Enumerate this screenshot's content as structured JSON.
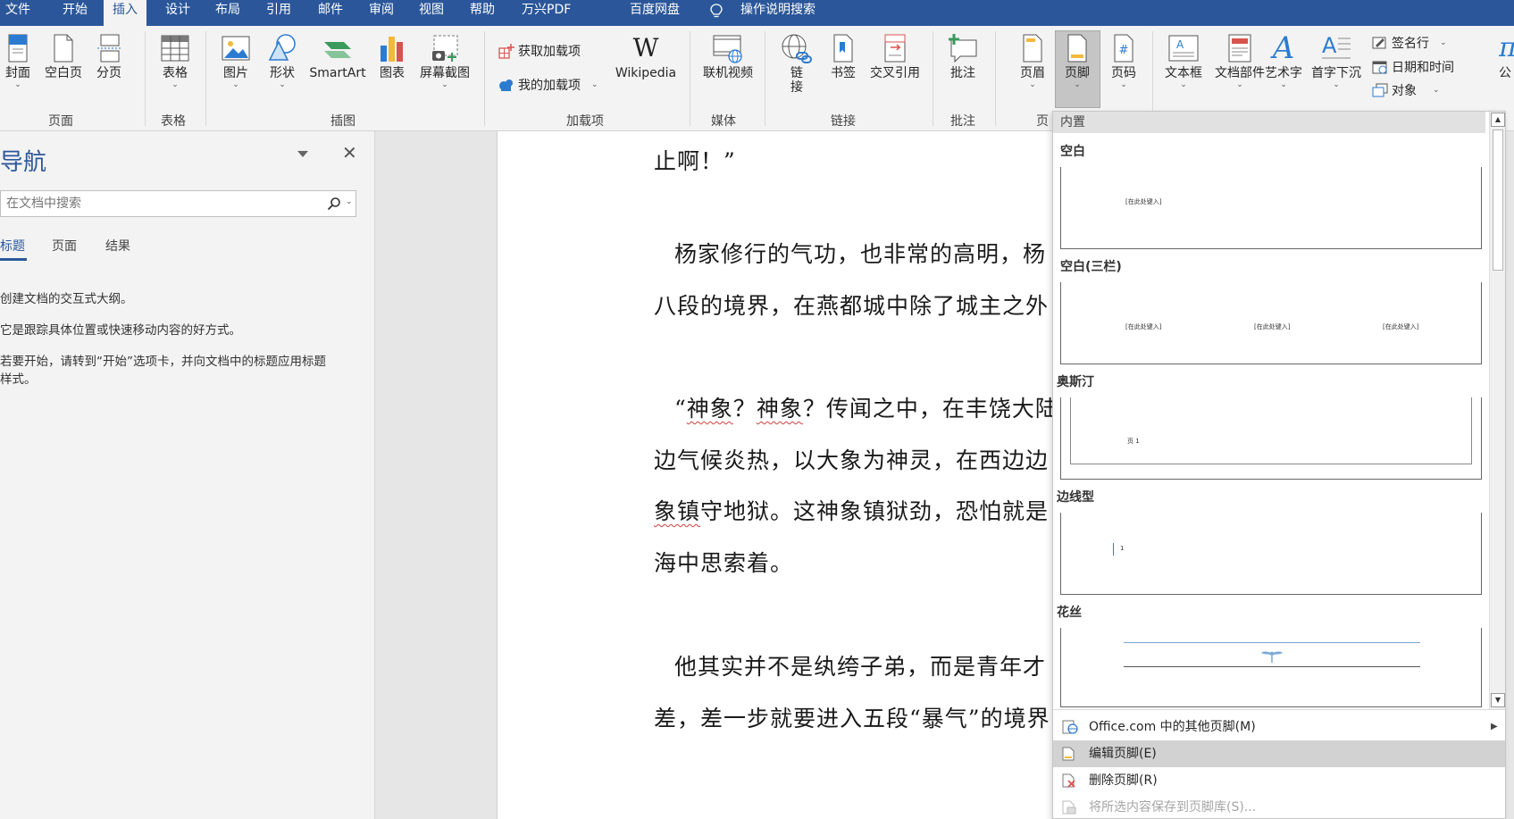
{
  "menubar": {
    "tabs": [
      "文件",
      "开始",
      "插入",
      "设计",
      "布局",
      "引用",
      "邮件",
      "审阅",
      "视图",
      "帮助",
      "万兴PDF",
      "百度网盘"
    ],
    "active_tab": "插入",
    "tell_me": "操作说明搜索"
  },
  "ribbon": {
    "pages": {
      "cover": "封面",
      "blank": "空白页",
      "break": "分页",
      "group": "页面"
    },
    "tables": {
      "table": "表格",
      "group": "表格"
    },
    "illustrations": {
      "picture": "图片",
      "shapes": "形状",
      "smartart": "SmartArt",
      "chart": "图表",
      "screenshot": "屏幕截图",
      "group": "插图"
    },
    "addins": {
      "get": "获取加载项",
      "mine": "我的加载项",
      "wikipedia": "Wikipedia",
      "group": "加载项"
    },
    "media": {
      "video": "联机视频",
      "group": "媒体"
    },
    "links": {
      "link_1": "链",
      "link_2": "接",
      "bookmark": "书签",
      "crossref": "交叉引用",
      "group": "链接"
    },
    "comments": {
      "comment": "批注",
      "group": "批注"
    },
    "header_footer": {
      "header": "页眉",
      "footer": "页脚",
      "page_number": "页码",
      "group": "页"
    },
    "text": {
      "textbox": "文本框",
      "quickparts": "文档部件",
      "wordart": "艺术字",
      "dropcap": "首字下沉",
      "signature": "签名行",
      "datetime": "日期和时间",
      "object": "对象",
      "edge_char": "公"
    }
  },
  "nav": {
    "title": "导航",
    "search_placeholder": "在文档中搜索",
    "tabs": [
      "标题",
      "页面",
      "结果"
    ],
    "line1": "创建文档的交互式大纲。",
    "line2": "它是跟踪具体位置或快速移动内容的好方式。",
    "line3a": "若要开始，请转到“开始”选项卡，并向文档中的标题应用标题",
    "line3b": "样式。"
  },
  "document": {
    "p0": "止啊！”",
    "p1a": "杨家修行的气功，也非常的高明，杨",
    "p1b": "八段的境界，在燕都城中除了城主之外",
    "p2a_1": "“",
    "p2a_2": "神象",
    "p2a_3": "？",
    "p2a_4": "神象",
    "p2a_5": "？传闻之中，在丰饶大陆",
    "p2b": "边气候炎热，以大象为神灵，在西边边",
    "p2c_1": "象镇",
    "p2c_2": "守地狱。这神象镇狱劲，恐怕就是",
    "p2d": "海中思索着。",
    "p3a": "他其实并不是纨绔子弟，而是青年才",
    "p3b": "差，差一步就要进入五段“暴气”的境界"
  },
  "footer_gallery": {
    "header": "内置",
    "items": [
      {
        "name": "空白",
        "placeholder": "[在此处键入]"
      },
      {
        "name": "空白(三栏)",
        "placeholder": "[在此处键入]"
      },
      {
        "name": "奥斯汀",
        "placeholder": "页 1"
      },
      {
        "name": "边线型",
        "placeholder": "1"
      },
      {
        "name": "花丝"
      }
    ],
    "menu": {
      "more": "Office.com 中的其他页脚(M)",
      "edit": "编辑页脚(E)",
      "remove": "删除页脚(R)",
      "save": "将所选内容保存到页脚库(S)..."
    }
  }
}
